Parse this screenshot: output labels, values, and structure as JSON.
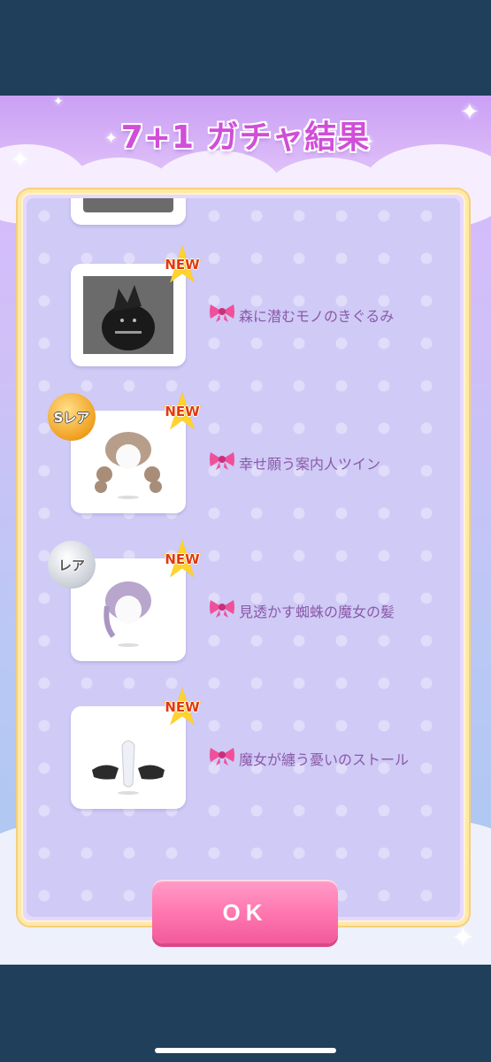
{
  "title": "7+1 ガチャ結果",
  "colors": {
    "accent": "#d04ed8",
    "ok_button": "#ff78b0",
    "item_text": "#8b5aa8",
    "panel_border": "#f7cf7a"
  },
  "items": [
    {
      "name": "森に潜むモノのきぐるみ",
      "new_label": "NEW",
      "rarity": "",
      "thumb": "dark-costume"
    },
    {
      "name": "幸せ願う案内人ツイン",
      "new_label": "NEW",
      "rarity": "Sレア",
      "thumb": "twin-hair"
    },
    {
      "name": "見透かす蜘蛛の魔女の髪",
      "new_label": "NEW",
      "rarity": "レア",
      "thumb": "lavender-hair"
    },
    {
      "name": "魔女が纏う憂いのストール",
      "new_label": "NEW",
      "rarity": "",
      "thumb": "stole"
    }
  ],
  "ok_label": "OK",
  "icons": {
    "item_type": "bow-icon",
    "new": "star-badge-icon"
  }
}
